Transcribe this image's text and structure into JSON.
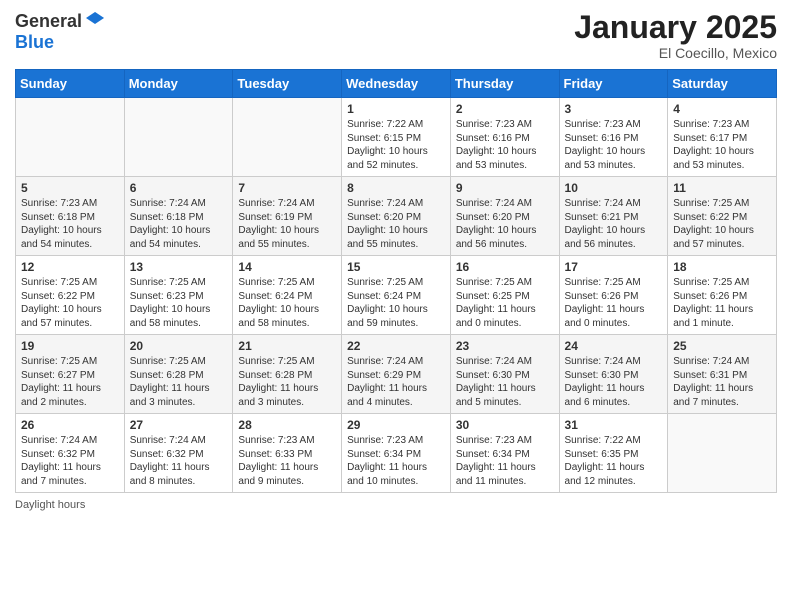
{
  "header": {
    "logo_general": "General",
    "logo_blue": "Blue",
    "month_title": "January 2025",
    "location": "El Coecillo, Mexico"
  },
  "days_of_week": [
    "Sunday",
    "Monday",
    "Tuesday",
    "Wednesday",
    "Thursday",
    "Friday",
    "Saturday"
  ],
  "weeks": [
    [
      {
        "day": "",
        "info": ""
      },
      {
        "day": "",
        "info": ""
      },
      {
        "day": "",
        "info": ""
      },
      {
        "day": "1",
        "info": "Sunrise: 7:22 AM\nSunset: 6:15 PM\nDaylight: 10 hours\nand 52 minutes."
      },
      {
        "day": "2",
        "info": "Sunrise: 7:23 AM\nSunset: 6:16 PM\nDaylight: 10 hours\nand 53 minutes."
      },
      {
        "day": "3",
        "info": "Sunrise: 7:23 AM\nSunset: 6:16 PM\nDaylight: 10 hours\nand 53 minutes."
      },
      {
        "day": "4",
        "info": "Sunrise: 7:23 AM\nSunset: 6:17 PM\nDaylight: 10 hours\nand 53 minutes."
      }
    ],
    [
      {
        "day": "5",
        "info": "Sunrise: 7:23 AM\nSunset: 6:18 PM\nDaylight: 10 hours\nand 54 minutes."
      },
      {
        "day": "6",
        "info": "Sunrise: 7:24 AM\nSunset: 6:18 PM\nDaylight: 10 hours\nand 54 minutes."
      },
      {
        "day": "7",
        "info": "Sunrise: 7:24 AM\nSunset: 6:19 PM\nDaylight: 10 hours\nand 55 minutes."
      },
      {
        "day": "8",
        "info": "Sunrise: 7:24 AM\nSunset: 6:20 PM\nDaylight: 10 hours\nand 55 minutes."
      },
      {
        "day": "9",
        "info": "Sunrise: 7:24 AM\nSunset: 6:20 PM\nDaylight: 10 hours\nand 56 minutes."
      },
      {
        "day": "10",
        "info": "Sunrise: 7:24 AM\nSunset: 6:21 PM\nDaylight: 10 hours\nand 56 minutes."
      },
      {
        "day": "11",
        "info": "Sunrise: 7:25 AM\nSunset: 6:22 PM\nDaylight: 10 hours\nand 57 minutes."
      }
    ],
    [
      {
        "day": "12",
        "info": "Sunrise: 7:25 AM\nSunset: 6:22 PM\nDaylight: 10 hours\nand 57 minutes."
      },
      {
        "day": "13",
        "info": "Sunrise: 7:25 AM\nSunset: 6:23 PM\nDaylight: 10 hours\nand 58 minutes."
      },
      {
        "day": "14",
        "info": "Sunrise: 7:25 AM\nSunset: 6:24 PM\nDaylight: 10 hours\nand 58 minutes."
      },
      {
        "day": "15",
        "info": "Sunrise: 7:25 AM\nSunset: 6:24 PM\nDaylight: 10 hours\nand 59 minutes."
      },
      {
        "day": "16",
        "info": "Sunrise: 7:25 AM\nSunset: 6:25 PM\nDaylight: 11 hours\nand 0 minutes."
      },
      {
        "day": "17",
        "info": "Sunrise: 7:25 AM\nSunset: 6:26 PM\nDaylight: 11 hours\nand 0 minutes."
      },
      {
        "day": "18",
        "info": "Sunrise: 7:25 AM\nSunset: 6:26 PM\nDaylight: 11 hours\nand 1 minute."
      }
    ],
    [
      {
        "day": "19",
        "info": "Sunrise: 7:25 AM\nSunset: 6:27 PM\nDaylight: 11 hours\nand 2 minutes."
      },
      {
        "day": "20",
        "info": "Sunrise: 7:25 AM\nSunset: 6:28 PM\nDaylight: 11 hours\nand 3 minutes."
      },
      {
        "day": "21",
        "info": "Sunrise: 7:25 AM\nSunset: 6:28 PM\nDaylight: 11 hours\nand 3 minutes."
      },
      {
        "day": "22",
        "info": "Sunrise: 7:24 AM\nSunset: 6:29 PM\nDaylight: 11 hours\nand 4 minutes."
      },
      {
        "day": "23",
        "info": "Sunrise: 7:24 AM\nSunset: 6:30 PM\nDaylight: 11 hours\nand 5 minutes."
      },
      {
        "day": "24",
        "info": "Sunrise: 7:24 AM\nSunset: 6:30 PM\nDaylight: 11 hours\nand 6 minutes."
      },
      {
        "day": "25",
        "info": "Sunrise: 7:24 AM\nSunset: 6:31 PM\nDaylight: 11 hours\nand 7 minutes."
      }
    ],
    [
      {
        "day": "26",
        "info": "Sunrise: 7:24 AM\nSunset: 6:32 PM\nDaylight: 11 hours\nand 7 minutes."
      },
      {
        "day": "27",
        "info": "Sunrise: 7:24 AM\nSunset: 6:32 PM\nDaylight: 11 hours\nand 8 minutes."
      },
      {
        "day": "28",
        "info": "Sunrise: 7:23 AM\nSunset: 6:33 PM\nDaylight: 11 hours\nand 9 minutes."
      },
      {
        "day": "29",
        "info": "Sunrise: 7:23 AM\nSunset: 6:34 PM\nDaylight: 11 hours\nand 10 minutes."
      },
      {
        "day": "30",
        "info": "Sunrise: 7:23 AM\nSunset: 6:34 PM\nDaylight: 11 hours\nand 11 minutes."
      },
      {
        "day": "31",
        "info": "Sunrise: 7:22 AM\nSunset: 6:35 PM\nDaylight: 11 hours\nand 12 minutes."
      },
      {
        "day": "",
        "info": ""
      }
    ]
  ],
  "footer": {
    "daylight_label": "Daylight hours"
  }
}
